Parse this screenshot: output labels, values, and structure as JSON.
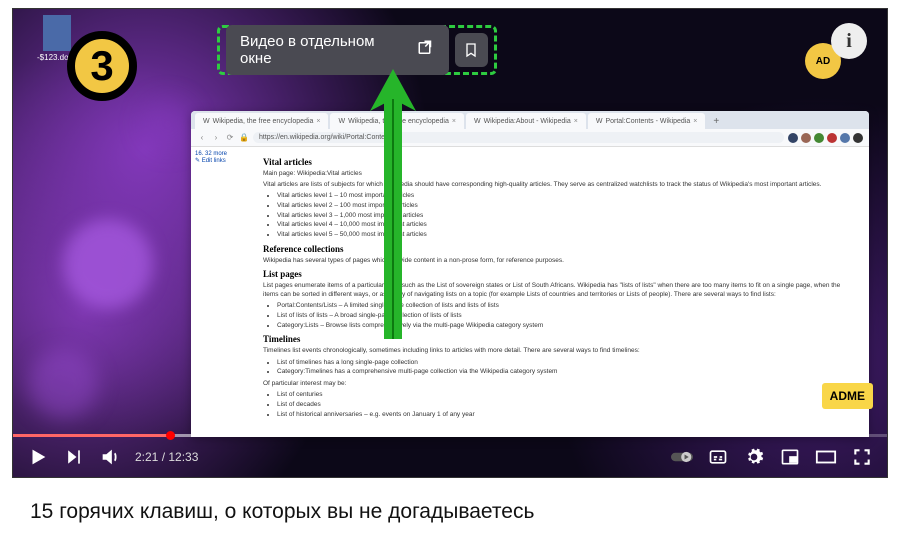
{
  "doc_label": "-$123.docx",
  "badge_number": "3",
  "popup": {
    "label": "Видео в отдельном окне"
  },
  "ad_partial": "AD",
  "browser": {
    "tabs": [
      {
        "label": "Wikipedia, the free encyclopedia"
      },
      {
        "label": "Wikipedia, the free encyclopedia"
      },
      {
        "label": "Wikipedia:About - Wikipedia"
      },
      {
        "label": "Portal:Contents - Wikipedia"
      }
    ],
    "url": "https://en.wikipedia.org/wiki/Portal:Contents",
    "sidebar": {
      "item1": "16. 32 more",
      "item2": "✎ Edit links"
    },
    "sections": {
      "vital_title": "Vital articles",
      "vital_main": "Main page: Wikipedia:Vital articles",
      "vital_p": "Vital articles are lists of subjects for which Wikipedia should have corresponding high-quality articles. They serve as centralized watchlists to track the status of Wikipedia's most important articles.",
      "vital_items": [
        "Vital articles level 1 – 10 most important articles",
        "Vital articles level 2 – 100 most important articles",
        "Vital articles level 3 – 1,000 most important articles",
        "Vital articles level 4 – 10,000 most important articles",
        "Vital articles level 5 – 50,000 most important articles"
      ],
      "ref_title": "Reference collections",
      "ref_p": "Wikipedia has several types of pages which provide content in a non-prose form, for reference purposes.",
      "list_title": "List pages",
      "list_p": "List pages enumerate items of a particular type, such as the List of sovereign states or List of South Africans. Wikipedia has \"lists of lists\" when there are too many items to fit on a single page, when the items can be sorted in different ways, or as a way of navigating lists on a topic (for example Lists of countries and territories or Lists of people). There are several ways to find lists:",
      "list_items": [
        "Portal:Contents/Lists – A limited single-page collection of lists and lists of lists",
        "List of lists of lists – A broad single-page collection of lists of lists",
        "Category:Lists – Browse lists comprehensively via the multi-page Wikipedia category system"
      ],
      "tl_title": "Timelines",
      "tl_p": "Timelines list events chronologically, sometimes including links to articles with more detail. There are several ways to find timelines:",
      "tl_items": [
        "List of timelines has a long single-page collection",
        "Category:Timelines has a comprehensive multi-page collection via the Wikipedia category system"
      ],
      "interest": "Of particular interest may be:",
      "interest_items": [
        "List of centuries",
        "List of decades",
        "List of historical anniversaries – e.g. events on January 1 of any year"
      ]
    }
  },
  "adme": "ADME",
  "player": {
    "current": "2:21",
    "sep": " / ",
    "total": "12:33"
  },
  "caption": "15 горячих клавиш, о которых вы не догадываетесь"
}
